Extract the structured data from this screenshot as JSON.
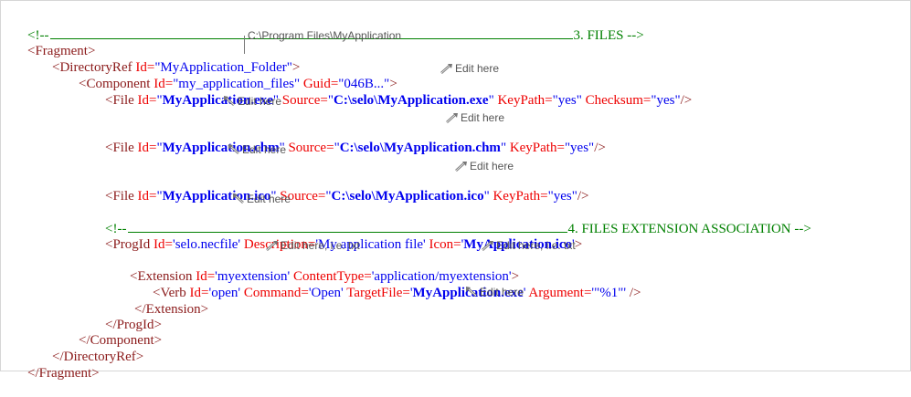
{
  "lines": {
    "c1": {
      "open": "<!--",
      "text": "3. FILES -->"
    },
    "fragment_open": "<Fragment>",
    "dirref": {
      "tag": "<DirectoryRef",
      "attr": " Id=",
      "val": "\"MyApplication_Folder\"",
      "close": ">"
    },
    "component": {
      "tag": "<Component",
      "a1": " Id=",
      "v1": "\"my_application_files\"",
      "a2": " Guid=",
      "v2": "\"046B...\"",
      "close": ">"
    },
    "file1": {
      "tag": "<File",
      "a1": " Id=",
      "q1": "\"",
      "v1": "MyApplication.exe",
      "q1e": "\"",
      "a2": " Source=",
      "q2": "\"",
      "v2": "C:\\selo\\MyApplication.exe",
      "q2e": "\"",
      "a3": " KeyPath=",
      "v3": "\"yes\"",
      "a4": " Checksum=",
      "v4": "\"yes\"",
      "close": "/>"
    },
    "file2": {
      "tag": "<File",
      "a1": " Id=",
      "q1": "\"",
      "v1": "MyApplication.chm",
      "q1e": "\"",
      "a2": " Source=",
      "q2": "\"",
      "v2": "C:\\selo\\MyApplication.chm",
      "q2e": "\"",
      "a3": " KeyPath=",
      "v3": "\"yes\"",
      "close": "/>"
    },
    "file3": {
      "tag": "<File",
      "a1": " Id=",
      "q1": "\"",
      "v1": "MyApplication.ico",
      "q1e": "\"",
      "a2": " Source=",
      "q2": "\"",
      "v2": "C:\\selo\\MyApplication.ico",
      "q2e": "\"",
      "a3": " KeyPath=",
      "v3": "\"yes\"",
      "close": "/>"
    },
    "c2": {
      "open": "<!--",
      "text": "4. FILES EXTENSION ASSOCIATION -->"
    },
    "progid": {
      "tag": "<ProgId",
      "a1": " Id=",
      "v1": "'selo.necfile'",
      "a2": " Description=",
      "v2": "'My application file'",
      "a3": " Icon=",
      "q3": "'",
      "v3": "MyApplication.ico",
      "q3e": "'",
      "close": ">"
    },
    "extension": {
      "tag": "<Extension",
      "a1": " Id=",
      "v1": "'myextension'",
      "a2": " ContentType=",
      "v2": "'application/myextension'",
      "close": ">"
    },
    "verb": {
      "tag": "<Verb",
      "a1": " Id=",
      "v1": "'open'",
      "a2": " Command=",
      "v2": "'Open'",
      "a3": " TargetFile=",
      "q3": "'",
      "v3": "MyApplication.exe",
      "q3e": "'",
      "a4": " Argument=",
      "v4": "'\"%1\"'",
      "close": " />"
    },
    "extension_close": "</Extension>",
    "progid_close": "</ProgId>",
    "component_close": "</Component>",
    "dirref_close": "</DirectoryRef>",
    "fragment_close": "</Fragment>"
  },
  "notes": {
    "path": "C:\\Program Files\\MyApplication",
    "edit": "Edit here",
    "edit_txt": "Edit here, i.e. txt"
  },
  "colors": {
    "tag": "#8b1a1a",
    "attribute": "#ee0000",
    "value": "#0000ee",
    "comment": "#008000"
  }
}
